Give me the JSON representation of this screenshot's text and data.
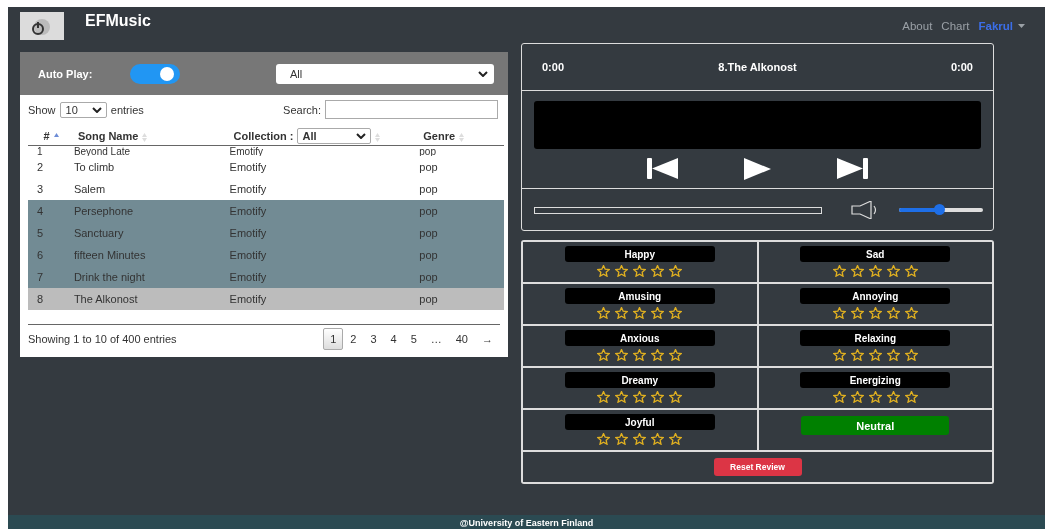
{
  "nav": {
    "brand": "EFMusic",
    "links": [
      {
        "label": "About",
        "selected": false
      },
      {
        "label": "Chart",
        "selected": false
      },
      {
        "label": "Fakrul",
        "selected": true
      }
    ]
  },
  "controls": {
    "auto_play_label": "Auto Play:",
    "auto_play": true,
    "playlist": "All"
  },
  "table": {
    "length_label_before": "Show",
    "length": "10",
    "length_label_after": "entries",
    "search_label": "Search:",
    "columns": [
      {
        "label": "#",
        "sorted": true
      },
      {
        "label": "Song Name",
        "sorted": false
      },
      {
        "label": "Collection :",
        "sorted": false,
        "filter": "All"
      },
      {
        "label": "Genre",
        "sorted": false
      }
    ],
    "rows": [
      {
        "cells": [
          "1",
          "Beyond Late",
          "Emotify",
          "pop"
        ],
        "marked": false,
        "playing": false
      },
      {
        "cells": [
          "2",
          "To climb",
          "Emotify",
          "pop"
        ],
        "marked": false,
        "playing": false
      },
      {
        "cells": [
          "3",
          "Salem",
          "Emotify",
          "pop"
        ],
        "marked": false,
        "playing": false
      },
      {
        "cells": [
          "4",
          "Persephone",
          "Emotify",
          "pop"
        ],
        "marked": true,
        "playing": false
      },
      {
        "cells": [
          "5",
          "Sanctuary",
          "Emotify",
          "pop"
        ],
        "marked": true,
        "playing": false
      },
      {
        "cells": [
          "6",
          "fifteen Minutes",
          "Emotify",
          "pop"
        ],
        "marked": true,
        "playing": false
      },
      {
        "cells": [
          "7",
          "Drink the night",
          "Emotify",
          "pop"
        ],
        "marked": true,
        "playing": false
      },
      {
        "cells": [
          "8",
          "The Alkonost",
          "Emotify",
          "pop"
        ],
        "marked": false,
        "playing": true
      }
    ],
    "info": "Showing 1 to 10 of 400 entries",
    "pages": [
      {
        "label": "1",
        "selected": true
      },
      {
        "label": "2",
        "selected": false
      },
      {
        "label": "3",
        "selected": false
      },
      {
        "label": "4",
        "selected": false
      },
      {
        "label": "5",
        "selected": false
      },
      {
        "label": "…",
        "selected": false
      },
      {
        "label": "40",
        "selected": false
      },
      {
        "label": "→",
        "selected": false
      }
    ]
  },
  "player": {
    "elapsed": "0:00",
    "track": "8.The Alkonost",
    "duration": "0:00",
    "progress": {
      "level": 0
    },
    "volume": {
      "level": 0.48
    }
  },
  "emotions": [
    {
      "kind": "rating",
      "label": "Happy",
      "stars": 0
    },
    {
      "kind": "rating",
      "label": "Sad",
      "stars": 0
    },
    {
      "kind": "rating",
      "label": "Amusing",
      "stars": 0
    },
    {
      "kind": "rating",
      "label": "Annoying",
      "stars": 0
    },
    {
      "kind": "rating",
      "label": "Anxious",
      "stars": 0
    },
    {
      "kind": "rating",
      "label": "Relaxing",
      "stars": 0
    },
    {
      "kind": "rating",
      "label": "Dreamy",
      "stars": 0
    },
    {
      "kind": "rating",
      "label": "Energizing",
      "stars": 0
    },
    {
      "kind": "rating",
      "label": "Joyful",
      "stars": 0
    },
    {
      "kind": "button",
      "label": "Neutral",
      "selected": true
    }
  ],
  "reset_button": "Reset Review",
  "footer": "@University of Eastern Finland"
}
